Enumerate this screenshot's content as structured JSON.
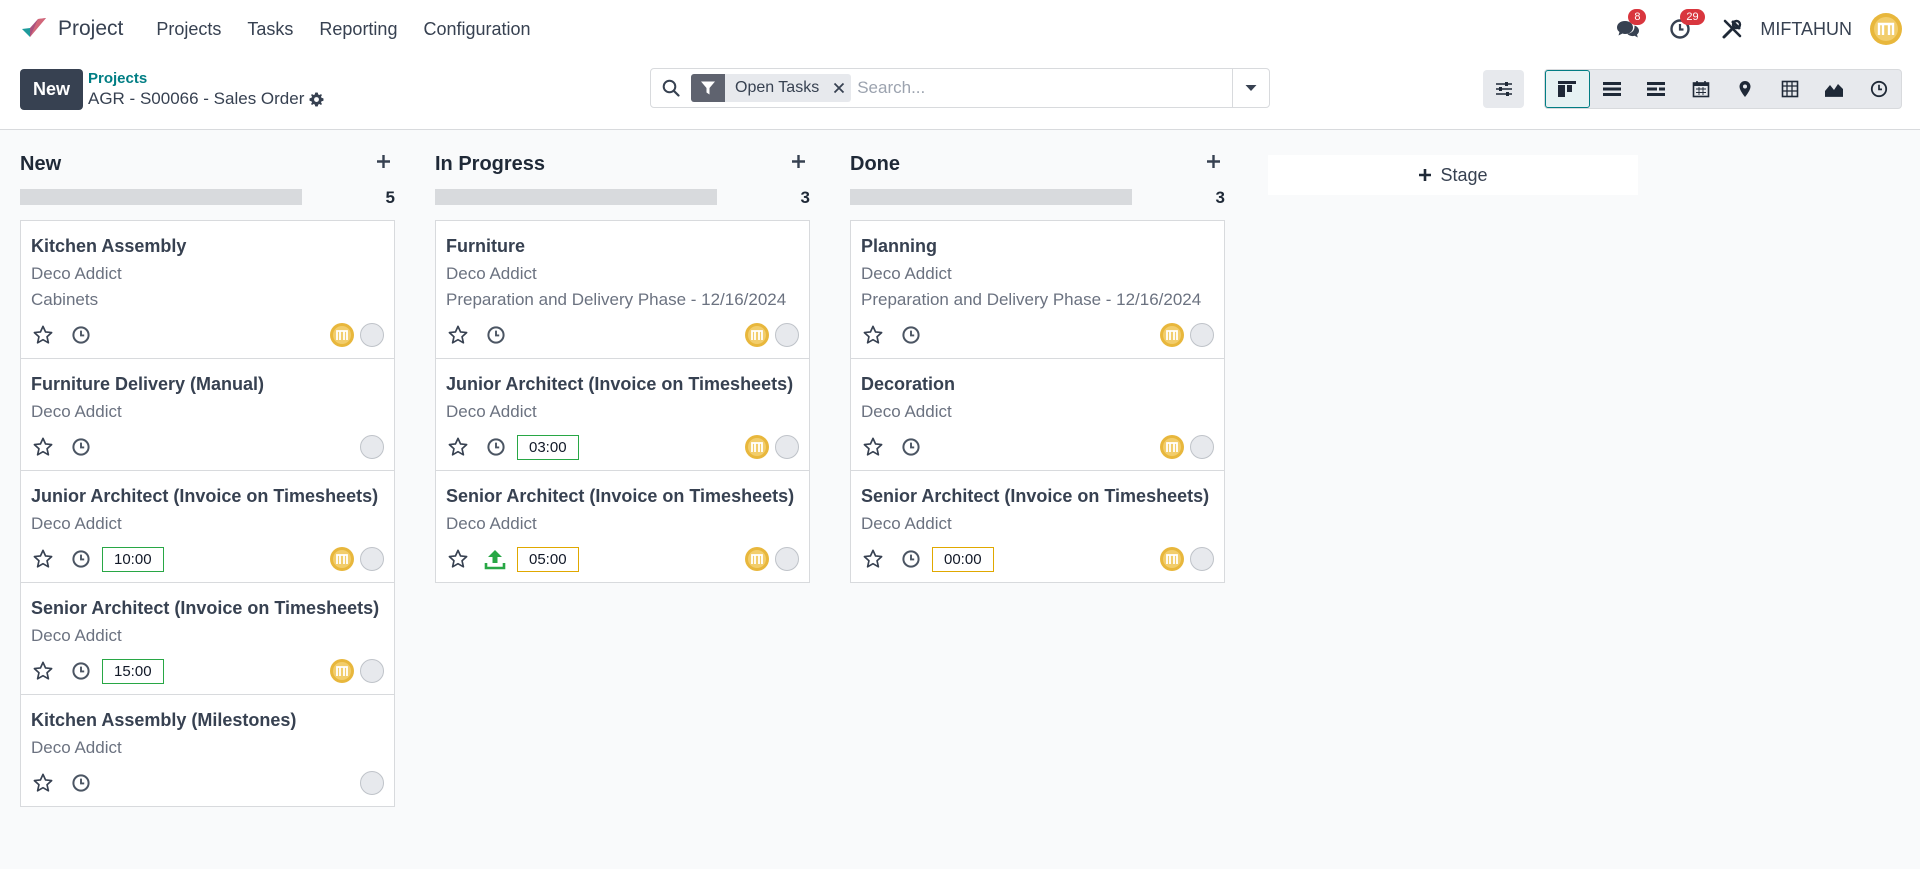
{
  "navbar": {
    "app_name": "Project",
    "menu": [
      "Projects",
      "Tasks",
      "Reporting",
      "Configuration"
    ],
    "messages_badge": "8",
    "activities_badge": "29",
    "user_name": "MIFTAHUN",
    "icons": [
      "project-logo-icon",
      "chat-icon",
      "activity-clock-icon",
      "tools-icon",
      "user-avatar"
    ]
  },
  "control_panel": {
    "new_label": "New",
    "breadcrumb_parent": "Projects",
    "breadcrumb_current": "AGR - S00066 - Sales Order",
    "search_facet": "Open Tasks",
    "search_placeholder": "Search...",
    "view_icons": [
      "kanban-view-icon",
      "list-view-icon",
      "gantt-view-icon",
      "calendar-view-icon",
      "map-view-icon",
      "pivot-view-icon",
      "graph-view-icon",
      "activity-view-icon"
    ],
    "active_view": "kanban"
  },
  "colors": {
    "primary": "#374151",
    "accent": "#017e84",
    "badge": "#d9363e",
    "hours_green": "#28a745",
    "hours_yellow": "#e0a800",
    "upload_green": "#28a745",
    "avatar_yellow": "#e8b73c"
  },
  "kanban": {
    "add_stage_label": "Stage",
    "columns": [
      {
        "title": "New",
        "count": "5",
        "cards": [
          {
            "title": "Kitchen Assembly",
            "partner": "Deco Addict",
            "extra": "Cabinets",
            "hours": "",
            "hours_color": "",
            "avatar": true,
            "upload": false
          },
          {
            "title": "Furniture Delivery (Manual)",
            "partner": "Deco Addict",
            "extra": "",
            "hours": "",
            "hours_color": "",
            "avatar": false,
            "upload": false
          },
          {
            "title": "Junior Architect (Invoice on Timesheets)",
            "partner": "Deco Addict",
            "extra": "",
            "hours": "10:00",
            "hours_color": "green",
            "avatar": true,
            "upload": false
          },
          {
            "title": "Senior Architect (Invoice on Timesheets)",
            "partner": "Deco Addict",
            "extra": "",
            "hours": "15:00",
            "hours_color": "green",
            "avatar": true,
            "upload": false
          },
          {
            "title": "Kitchen Assembly (Milestones)",
            "partner": "Deco Addict",
            "extra": "",
            "hours": "",
            "hours_color": "",
            "avatar": false,
            "upload": false
          }
        ]
      },
      {
        "title": "In Progress",
        "count": "3",
        "cards": [
          {
            "title": "Furniture",
            "partner": "Deco Addict",
            "extra": "Preparation and Delivery Phase - 12/16/2024",
            "hours": "",
            "hours_color": "",
            "avatar": true,
            "upload": false
          },
          {
            "title": "Junior Architect (Invoice on Timesheets)",
            "partner": "Deco Addict",
            "extra": "",
            "hours": "03:00",
            "hours_color": "green",
            "avatar": true,
            "upload": false
          },
          {
            "title": "Senior Architect (Invoice on Timesheets)",
            "partner": "Deco Addict",
            "extra": "",
            "hours": "05:00",
            "hours_color": "yellow",
            "avatar": true,
            "upload": true
          }
        ]
      },
      {
        "title": "Done",
        "count": "3",
        "cards": [
          {
            "title": "Planning",
            "partner": "Deco Addict",
            "extra": "Preparation and Delivery Phase - 12/16/2024",
            "hours": "",
            "hours_color": "",
            "avatar": true,
            "upload": false
          },
          {
            "title": "Decoration",
            "partner": "Deco Addict",
            "extra": "",
            "hours": "",
            "hours_color": "",
            "avatar": true,
            "upload": false
          },
          {
            "title": "Senior Architect (Invoice on Timesheets)",
            "partner": "Deco Addict",
            "extra": "",
            "hours": "00:00",
            "hours_color": "yellow",
            "avatar": true,
            "upload": false
          }
        ]
      }
    ]
  }
}
